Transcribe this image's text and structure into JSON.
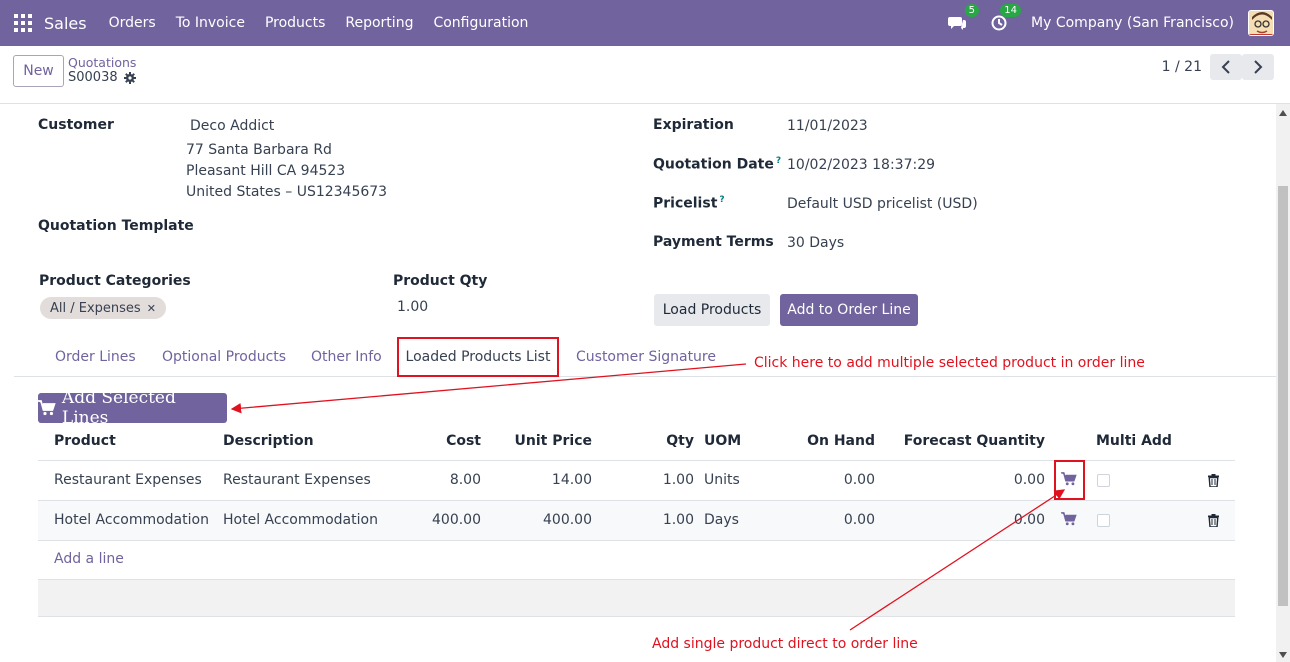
{
  "navbar": {
    "brand": "Sales",
    "menu": [
      "Orders",
      "To Invoice",
      "Products",
      "Reporting",
      "Configuration"
    ],
    "messages_count": "5",
    "activities_count": "14",
    "company": "My Company (San Francisco)"
  },
  "control": {
    "new_label": "New",
    "breadcrumb_parent": "Quotations",
    "breadcrumb_current": "S00038",
    "pager": "1 / 21"
  },
  "form": {
    "customer_label": "Customer",
    "customer_name": "Deco Addict",
    "address_line1": "77 Santa Barbara Rd",
    "address_line2": "Pleasant Hill CA 94523",
    "address_line3": "United States – US12345673",
    "template_label": "Quotation Template",
    "expiration_label": "Expiration",
    "expiration_value": "11/01/2023",
    "quotation_date_label": "Quotation Date",
    "quotation_date_value": "10/02/2023 18:37:29",
    "pricelist_label": "Pricelist",
    "pricelist_value": "Default USD pricelist (USD)",
    "payment_terms_label": "Payment Terms",
    "payment_terms_value": "30 Days",
    "help_mark": "?",
    "product_categories_label": "Product Categories",
    "category_tag": "All / Expenses",
    "product_qty_label": "Product Qty",
    "product_qty_value": "1.00",
    "load_products_label": "Load Products",
    "add_to_order_line_label": "Add to Order Line"
  },
  "tabs": [
    "Order Lines",
    "Optional Products",
    "Other Info",
    "Loaded Products List",
    "Customer Signature"
  ],
  "active_tab": "Loaded Products List",
  "add_selected_label": "Add Selected Lines",
  "table": {
    "headers": [
      "Product",
      "Description",
      "Cost",
      "Unit Price",
      "Qty",
      "UOM",
      "On Hand",
      "Forecast Quantity",
      "Multi Add"
    ],
    "rows": [
      {
        "product": "Restaurant Expenses",
        "description": "Restaurant Expenses",
        "cost": "8.00",
        "unit_price": "14.00",
        "qty": "1.00",
        "uom": "Units",
        "on_hand": "0.00",
        "forecast": "0.00"
      },
      {
        "product": "Hotel Accommodation",
        "description": "Hotel Accommodation",
        "cost": "400.00",
        "unit_price": "400.00",
        "qty": "1.00",
        "uom": "Days",
        "on_hand": "0.00",
        "forecast": "0.00"
      }
    ],
    "add_line_label": "Add a line"
  },
  "annotations": {
    "multi_note": "Click here to add multiple selected product in order line",
    "single_note": "Add single product direct to order line"
  },
  "colors": {
    "brand": "#71639e",
    "annotation": "#e0121f"
  }
}
